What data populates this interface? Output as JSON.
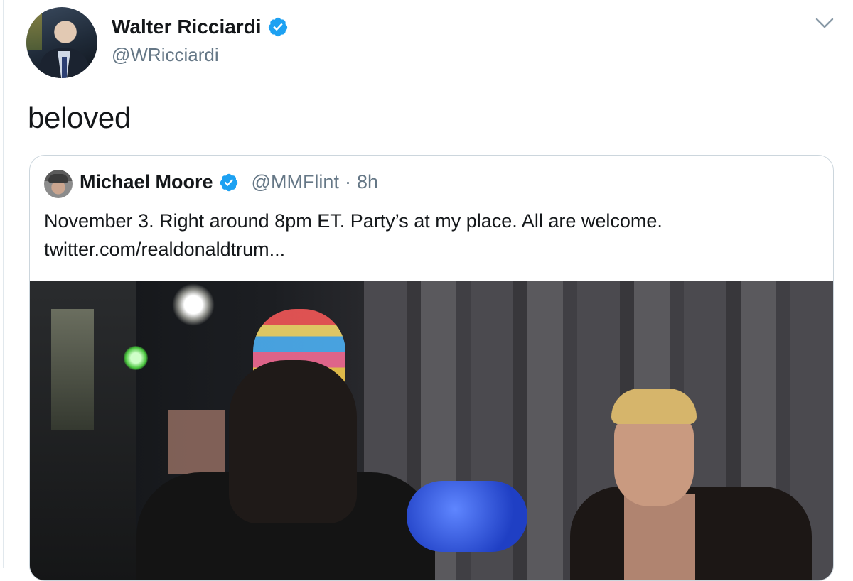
{
  "tweet": {
    "author_name": "Walter Ricciardi",
    "author_handle": "@WRicciardi",
    "text": "beloved"
  },
  "quoted_tweet": {
    "author_name": "Michael Moore",
    "author_handle": "@MMFlint",
    "separator": "·",
    "time": "8h",
    "text_line1": "November 3.  Right around 8pm ET. Party’s at my place. All are welcome.",
    "text_line2": "twitter.com/realdonaldtrum..."
  },
  "colors": {
    "verified": "#1da1f2",
    "secondary_text": "#657786",
    "border": "#ccd6dd"
  },
  "icons": {
    "verified": "verified-badge-icon",
    "caret": "chevron-down-icon"
  }
}
